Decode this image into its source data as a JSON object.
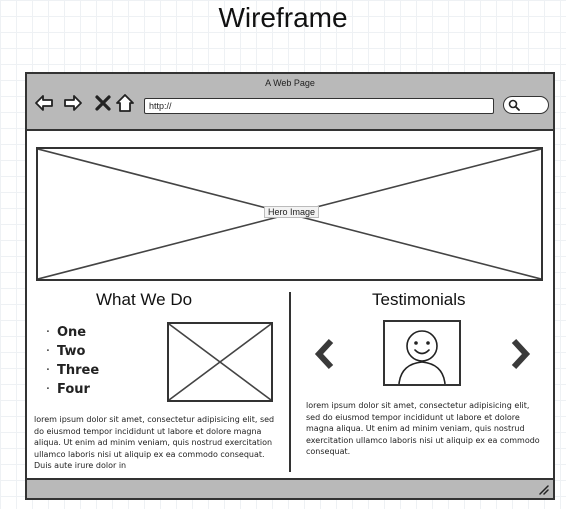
{
  "page": {
    "heading": "Wireframe"
  },
  "browser": {
    "title": "A Web Page",
    "url": "http://",
    "nav": {
      "back_icon": "arrow-left-icon",
      "forward_icon": "arrow-right-icon",
      "stop_icon": "close-icon",
      "home_icon": "home-icon"
    },
    "search_icon": "search-icon"
  },
  "hero": {
    "label": "Hero Image"
  },
  "what_we_do": {
    "title": "What We Do",
    "items": [
      "One",
      "Two",
      "Three",
      "Four"
    ],
    "body": "lorem ipsum dolor sit amet, consectetur adipisicing elit, sed do eiusmod tempor incididunt ut labore et dolore magna aliqua. Ut enim ad minim veniam, quis nostrud exercitation ullamco laboris nisi ut aliquip ex ea commodo consequat. Duis aute irure dolor in"
  },
  "testimonials": {
    "title": "Testimonials",
    "prev_icon": "chevron-left-icon",
    "next_icon": "chevron-right-icon",
    "avatar_icon": "smiley-person-icon",
    "body": "lorem ipsum dolor sit amet, consectetur adipisicing elit, sed do eiusmod tempor incididunt ut labore et dolore magna aliqua. Ut enim ad minim veniam, quis nostrud exercitation ullamco laboris nisi ut aliquip ex ea commodo consequat."
  },
  "status_bar": {
    "grip_icon": "resize-grip-icon"
  }
}
